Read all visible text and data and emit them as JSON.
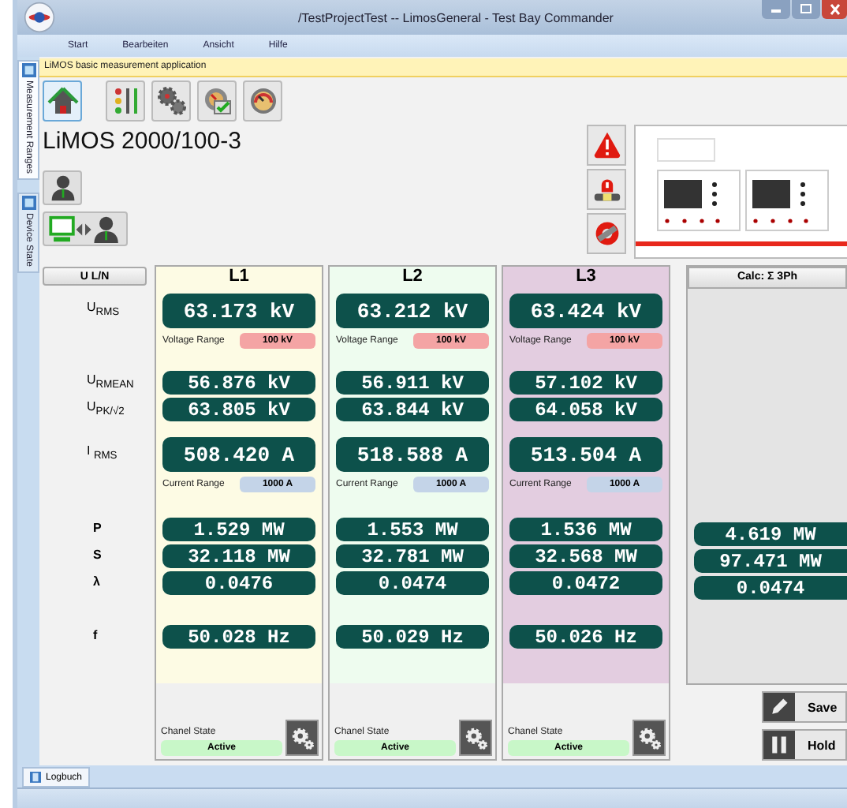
{
  "window": {
    "title": "/TestProjectTest -- LimosGeneral - Test Bay Commander"
  },
  "menu": [
    "Start",
    "Bearbeiten",
    "Ansicht",
    "Hilfe"
  ],
  "side_tabs": [
    {
      "label": "Measurement Ranges",
      "selected": true
    },
    {
      "label": "Device State",
      "selected": false
    }
  ],
  "info_bar": "LiMOS basic measurement application",
  "device_title": "LiMOS 2000/100-3",
  "label_column": {
    "header": "U L/N",
    "rows": [
      "U$_{RMS}$",
      "U$_{RMEAN}$",
      "U$_{PK/√2}$",
      "I $_{RMS}$",
      "P",
      "S",
      "λ",
      "f"
    ]
  },
  "phases": [
    {
      "name": "L1",
      "color": "#fdfbe4",
      "urms": "63.173 kV",
      "voltage_range_label": "Voltage Range",
      "voltage_range": "100 kV",
      "urmean": "56.876 kV",
      "upk": "63.805 kV",
      "irms": "508.420 A",
      "current_range_label": "Current Range",
      "current_range": "1000 A",
      "p": "1.529 MW",
      "s": "32.118 MW",
      "lambda": "0.0476",
      "f": "50.028 Hz",
      "state_label": "Chanel State",
      "state": "Active"
    },
    {
      "name": "L2",
      "color": "#eefcef",
      "urms": "63.212 kV",
      "voltage_range_label": "Voltage Range",
      "voltage_range": "100 kV",
      "urmean": "56.911 kV",
      "upk": "63.844 kV",
      "irms": "518.588 A",
      "current_range_label": "Current Range",
      "current_range": "1000 A",
      "p": "1.553 MW",
      "s": "32.781 MW",
      "lambda": "0.0474",
      "f": "50.029 Hz",
      "state_label": "Chanel State",
      "state": "Active"
    },
    {
      "name": "L3",
      "color": "#e3cde0",
      "urms": "63.424 kV",
      "voltage_range_label": "Voltage Range",
      "voltage_range": "100 kV",
      "urmean": "57.102 kV",
      "upk": "64.058 kV",
      "irms": "513.504 A",
      "current_range_label": "Current Range",
      "current_range": "1000 A",
      "p": "1.536 MW",
      "s": "32.568 MW",
      "lambda": "0.0472",
      "f": "50.026 Hz",
      "state_label": "Chanel State",
      "state": "Active"
    }
  ],
  "calc": {
    "header": "Calc: Σ 3Ph",
    "p": "4.619 MW",
    "s": "97.471 MW",
    "lambda": "0.0474"
  },
  "buttons": [
    {
      "kind": "save",
      "label": "Save"
    },
    {
      "kind": "hold",
      "label": "Hold"
    }
  ],
  "bottom_tabs": [
    "Logbuch"
  ]
}
